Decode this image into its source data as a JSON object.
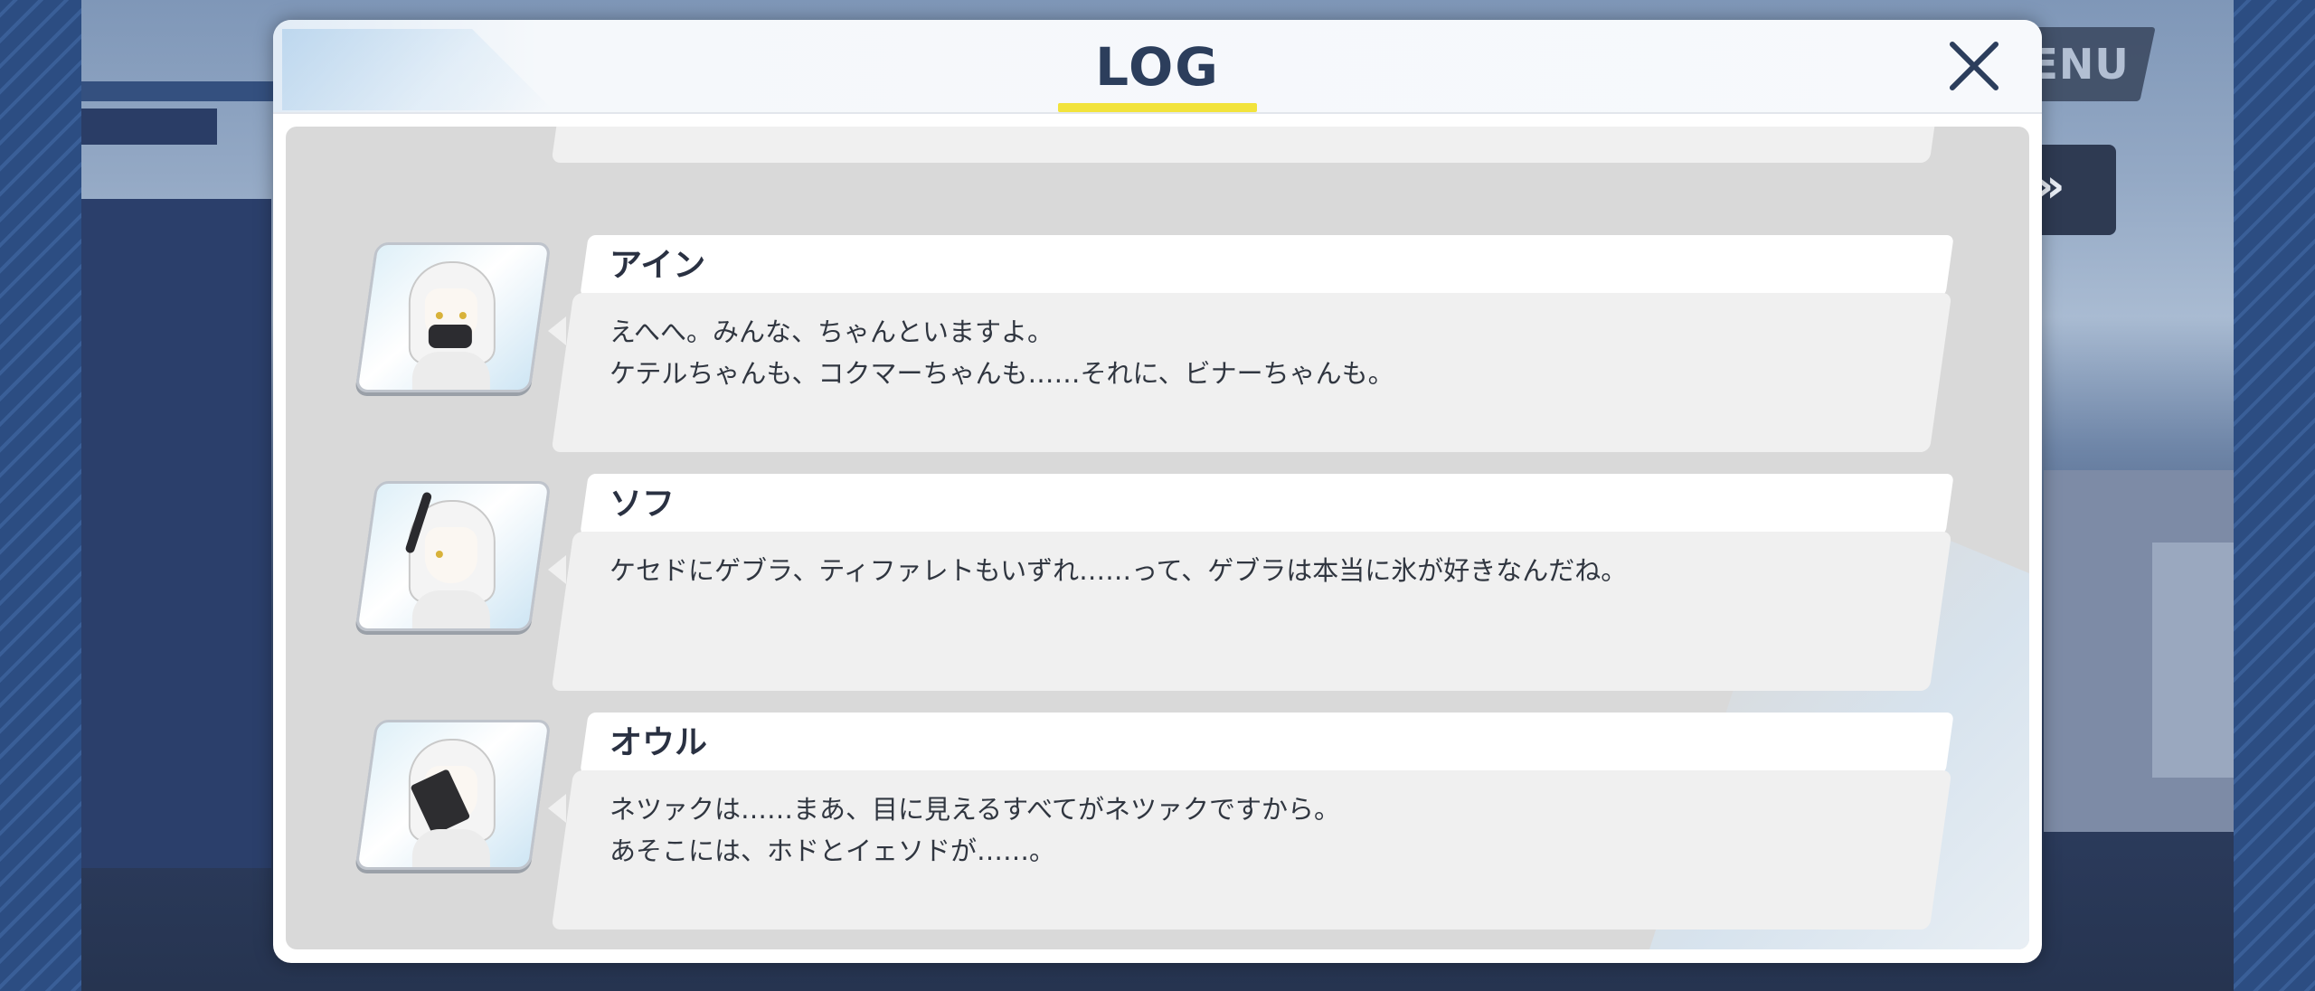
{
  "background": {
    "menu_button_label": "ENU",
    "skip_button_label": "»"
  },
  "log": {
    "title": "LOG",
    "close_label": "×",
    "entries": [
      {
        "speaker": "",
        "lines": [
          "",
          ""
        ],
        "avatar_icon": "character-portrait-icon"
      },
      {
        "speaker": "アイン",
        "lines": [
          "えへへ。みんな、ちゃんといますよ。",
          "ケテルちゃんも、コクマーちゃんも……それに、ビナーちゃんも。"
        ],
        "avatar_icon": "ain-portrait-icon"
      },
      {
        "speaker": "ソフ",
        "lines": [
          "ケセドにゲブラ、ティファレトもいずれ……って、ゲブラは本当に氷が好きなんだね。",
          ""
        ],
        "avatar_icon": "soph-portrait-icon"
      },
      {
        "speaker": "オウル",
        "lines": [
          "ネツァクは……まあ、目に見えるすべてがネツァクですから。",
          "あそこには、ホドとイェソドが……。"
        ],
        "avatar_icon": "aur-portrait-icon"
      }
    ]
  },
  "colors": {
    "title_text": "#2c3e5c",
    "title_underline": "#f2e33c",
    "list_background": "#d9d9d9",
    "bubble": "#f0f0f0"
  }
}
